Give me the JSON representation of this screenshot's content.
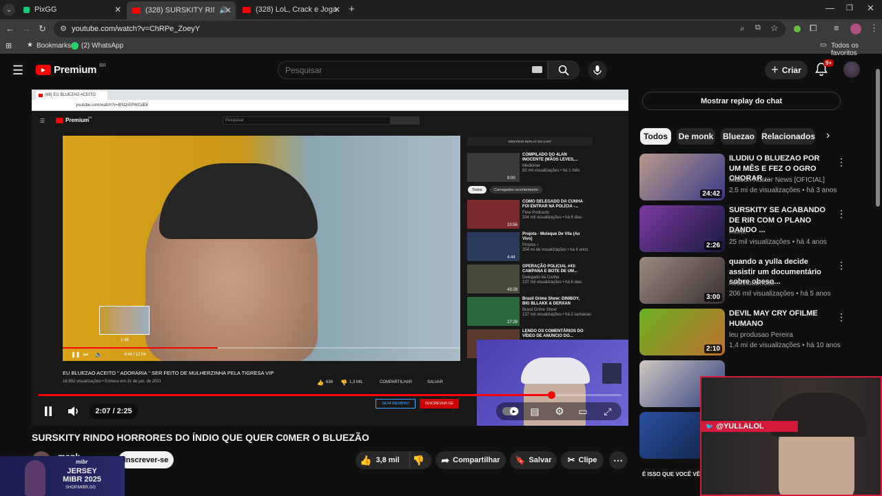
{
  "browser": {
    "tabs": [
      {
        "title": "PixGG"
      },
      {
        "title": "(328) SURSKITY RINDO HO"
      },
      {
        "title": "(328) LoL, Crack e Jogar a Vô d"
      }
    ],
    "url": "youtube.com/watch?v=ChRPe_ZoeyY",
    "bookmarks": [
      {
        "label": "Bookmarks"
      },
      {
        "label": "(2) WhatsApp"
      }
    ],
    "all_favorites": "Todos os favoritos"
  },
  "youtube": {
    "logo_text": "Premium",
    "logo_region": "BR",
    "search_placeholder": "Pesquisar",
    "create_label": "Criar",
    "notification_badge": "9+",
    "chat_replay_label": "Mostrar replay do chat",
    "chips": [
      {
        "label": "Todos"
      },
      {
        "label": "De monk"
      },
      {
        "label": "Bluezao"
      },
      {
        "label": "Relacionados"
      }
    ],
    "player": {
      "time": "2:07 / 2:25",
      "progress_fraction": 0.88
    },
    "video": {
      "title": "SURSKITY RINDO HORRORES DO ÍNDIO QUE QUER C0MER O BLUEZÃO",
      "channel": "monk",
      "subscribe_label": "Inscrever-se",
      "likes": "3,8 mil",
      "share_label": "Compartilhar",
      "save_label": "Salvar",
      "clip_label": "Clipe"
    },
    "recommendations": [
      {
        "title": "ILUDIU O BLUEZAO POR UM MÊS E FEZ O OGRO CHORAR ...",
        "channel": "Maicon Küster News [OFICIAL]",
        "stats": "2,5 mi de visualizações • há 3 anos",
        "duration": "24:42",
        "thumb_colors": [
          "#b89a8a",
          "#3a3a8a"
        ]
      },
      {
        "title": "SURSKITY SE ACABANDO DE RIR COM O PLANO DANDO ...",
        "channel": "monk",
        "stats": "25 mil visualizações • há 4 anos",
        "duration": "2:26",
        "thumb_colors": [
          "#7a3aa0",
          "#1a1a40"
        ]
      },
      {
        "title": "quando a yulla decide assistir um documentário sobre obeso...",
        "channel": "netinhofamoso",
        "stats": "206 mil visualizações • há 5 anos",
        "duration": "3:00",
        "thumb_colors": [
          "#9a8a80",
          "#3a3030"
        ]
      },
      {
        "title": "DEVIL MAY CRY OFILME HUMANO",
        "channel": "leu produsao Pereira",
        "stats": "1,4 mi de visualizações • há 10 anos",
        "duration": "2:10",
        "thumb_colors": [
          "#6ab020",
          "#c07030"
        ]
      },
      {
        "title": "",
        "channel": "",
        "stats": "",
        "duration": "",
        "thumb_colors": [
          "#d0c8c0",
          "#304080"
        ]
      },
      {
        "title": "",
        "channel": "",
        "stats": "",
        "duration": "",
        "thumb_colors": [
          "#2a50a0",
          "#102040"
        ]
      }
    ],
    "bottom_caption": "É ISSO QUE VOCÊ VÊ"
  },
  "embedded": {
    "tab": "(69) EU BLUEZAO ACEITO",
    "url": "youtube.com/watch?v=BSOrEPWCdE8",
    "logo_text": "Premium",
    "logo_region": "BR",
    "search_placeholder": "Pesquisar",
    "chat_replay": "MOSTRAR REPLAY DO CHAT",
    "chips": [
      {
        "label": "Todos"
      },
      {
        "label": "Carregados recentemente"
      }
    ],
    "hover_time": "1:48",
    "time": "4:44 / 12:04",
    "progress_fraction": 0.39,
    "title": "EU BLUEZAO ACEITO \" ADORARIA \" SER FEITO DE MULHERZINHA PELA TIGRESA VIP",
    "meta": "16.992 visualizações • Estreou em 31 de jan. de 2021",
    "likes": "636",
    "dislikes": "1,3 MIL",
    "share": "COMPARTILHAR",
    "save": "SALVAR",
    "member": "SEJA MEMBRO",
    "subscribe": "INSCREVER-SE",
    "recs": [
      {
        "title": "COMPILADO DO 4LAN INOCENTE (MÃOS LEVES,...",
        "channel": "Medisiner",
        "stats": "82 mil visualizações • há 1 mês",
        "duration": "9:00"
      },
      {
        "title": "COMO DELEGADO DA CUNHA FOI ENTRAR NA POLÍCIA -...",
        "channel": "Flow Podcasts",
        "stats": "334 mil visualizações • há 6 dias",
        "duration": "10:56"
      },
      {
        "title": "Projota - Muleque De Vila (Ao Vivo)",
        "channel": "Projota ♪",
        "stats": "354 mi de visualizações • há 4 anos",
        "duration": "4:44"
      },
      {
        "title": "OPERAÇÃO POLICIAL #43: CAMPANA E BOTE DE UM...",
        "channel": "Delegado da Cunha",
        "stats": "137 mil visualizações • há 6 dias",
        "duration": "43:28"
      },
      {
        "title": "Brasil Grime Show: DINIBOY, BIG BLLAKK & DERXAN",
        "channel": "Brasil Grime Show",
        "stats": "137 mil visualizações • há 2 semanas",
        "duration": "27:29"
      },
      {
        "title": "LENDO OS COMENTÁRIOS DO VÍDEO DE ANÚNCIO DO...",
        "channel": "",
        "stats": "",
        "duration": ""
      }
    ]
  },
  "overlays": {
    "twitter_handle": "@YULLALOL",
    "ad_brand": "mibr",
    "ad_title": "JERSEY MIBR 2025",
    "ad_url": "SHOP.MIBR.GG"
  }
}
